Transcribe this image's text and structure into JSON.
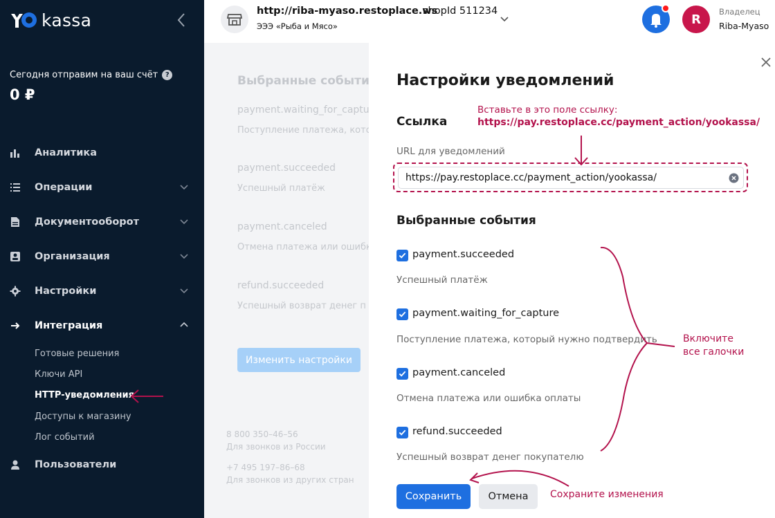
{
  "colors": {
    "sidebar_bg": "#0a1b2d",
    "accent": "#1e6fe0",
    "annotation": "#b3124c",
    "avatar": "#c8164b",
    "bell_dot": "#ff1a1a"
  },
  "logo": {
    "mark": "YO",
    "text": "kassa",
    "icon": "yookassa-logo-icon"
  },
  "balance": {
    "label": "Сегодня отправим на ваш счёт",
    "help": "?",
    "value": "0 ₽"
  },
  "sidebar": {
    "items": [
      {
        "label": "Аналитика",
        "icon": "bar-chart-icon"
      },
      {
        "label": "Операции",
        "icon": "list-icon"
      },
      {
        "label": "Документооборот",
        "icon": "document-icon"
      },
      {
        "label": "Организация",
        "icon": "id-card-icon"
      },
      {
        "label": "Настройки",
        "icon": "gear-icon"
      },
      {
        "label": "Интеграция",
        "icon": "arrow-right-icon"
      },
      {
        "label": "Пользователи",
        "icon": "user-icon"
      }
    ],
    "sub_items": [
      "Готовые решения",
      "Ключи API",
      "HTTP-уведомления",
      "Доступы к магазину",
      "Лог событий"
    ]
  },
  "header": {
    "shop_url": "http://riba-myaso.restoplace.ws",
    "shop_id": "shopId 511234",
    "shop_org": "ЭЭЭ «Рыба и Мясо»",
    "avatar_letter": "R",
    "user_role": "Владелец",
    "user_name": "Riba-Myaso"
  },
  "background": {
    "title": "Выбранные события",
    "events": [
      {
        "code": "payment.waiting_for_captu",
        "desc": "Поступление платежа, кото"
      },
      {
        "code": "payment.succeeded",
        "desc": "Успешный платёж"
      },
      {
        "code": "payment.canceled",
        "desc": "Отмена платежа или ошибк"
      },
      {
        "code": "refund.succeeded",
        "desc": "Успешный возврат денег п"
      }
    ],
    "button": "Изменить настройки",
    "phone1": "8 800 350–46–56",
    "phone1_desc": "Для звонков из России",
    "phone2": "+7 495 197–86–68",
    "phone2_desc": "Для звонков из других стран"
  },
  "modal": {
    "title": "Настройки уведомлений",
    "link_title": "Ссылка",
    "url_label": "URL для уведомлений",
    "url_value": "https://pay.restoplace.cc/payment_action/yookassa/",
    "events_title": "Выбранные события",
    "events": [
      {
        "code": "payment.succeeded",
        "desc": "Успешный платёж",
        "checked": true
      },
      {
        "code": "payment.waiting_for_capture",
        "desc": "Поступление платежа, который нужно подтвердить",
        "checked": true
      },
      {
        "code": "payment.canceled",
        "desc": "Отмена платежа или ошибка оплаты",
        "checked": true
      },
      {
        "code": "refund.succeeded",
        "desc": "Успешный возврат денег покупателю",
        "checked": true
      }
    ],
    "save": "Сохранить",
    "cancel": "Отмена"
  },
  "annotations": {
    "url_hint_line1": "Вставьте в это поле ссылку:",
    "url_hint_line2": "https://pay.restoplace.cc/payment_action/yookassa/",
    "checks_line1": "Включите",
    "checks_line2": "все галочки",
    "save_hint": "Сохраните изменения"
  }
}
